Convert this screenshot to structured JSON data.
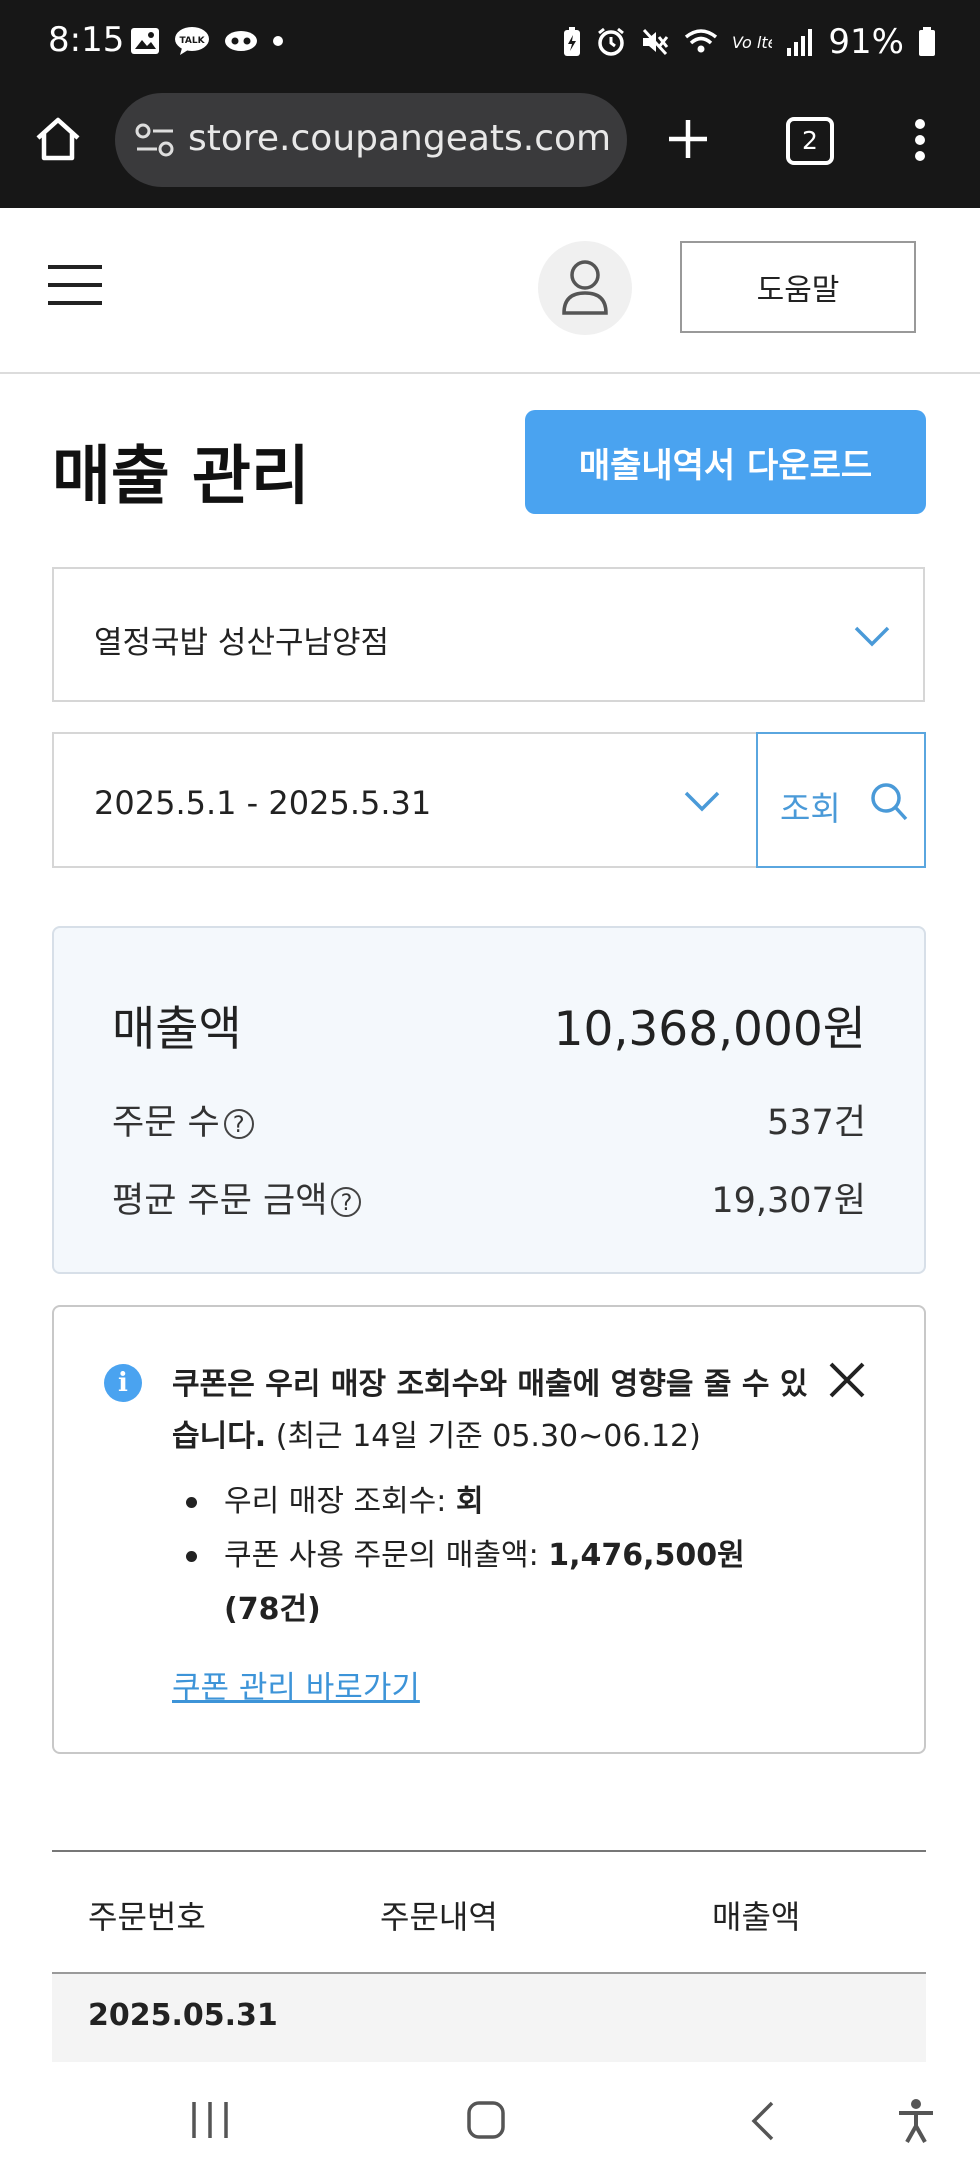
{
  "status_bar": {
    "time": "8:15",
    "battery": "91%"
  },
  "browser": {
    "url": "store.coupangeats.com",
    "tab_count": "2"
  },
  "header": {
    "help_label": "도움말"
  },
  "page": {
    "title": "매출 관리",
    "download_label": "매출내역서 다운로드"
  },
  "filters": {
    "store": "열정국밥 성산구남양점",
    "date_range": "2025.5.1 - 2025.5.31",
    "search_label": "조회"
  },
  "summary": {
    "sales_label": "매출액",
    "sales_value": "10,368,000원",
    "orders_label": "주문 수",
    "orders_value": "537건",
    "avg_label": "평균 주문 금액",
    "avg_value": "19,307원"
  },
  "notice": {
    "headline": "쿠폰은 우리 매장 조회수와 매출에 영향을 줄 수 있습니다.",
    "period": "(최근 14일 기준 05.30~06.12)",
    "bullet1_label": "우리 매장 조회수:",
    "bullet1_value": "회",
    "bullet2_label": "쿠폰 사용 주문의 매출액:",
    "bullet2_value": "1,476,500원 (78건)",
    "link": "쿠폰 관리 바로가기"
  },
  "table": {
    "columns": [
      "주문번호",
      "주문내역",
      "매출액"
    ],
    "date_group": "2025.05.31"
  },
  "colors": {
    "accent": "#4aa3f0",
    "summary_bg": "#f4f8fc",
    "statusbar_bg": "#171717"
  }
}
